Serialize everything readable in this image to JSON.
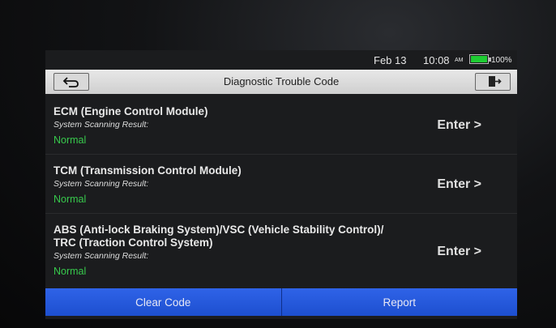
{
  "status": {
    "date": "Feb 13",
    "time": "10:08",
    "ampm": "AM",
    "battery_pct": "100%",
    "battery_level": 1.0
  },
  "header": {
    "title": "Diagnostic Trouble Code",
    "back_icon": "back-arrow-icon",
    "exit_icon": "exit-door-icon"
  },
  "systems": [
    {
      "name": "ECM (Engine Control Module)",
      "scan_label": "System Scanning Result:",
      "result": "Normal",
      "enter": "Enter >"
    },
    {
      "name": "TCM (Transmission Control Module)",
      "scan_label": "System Scanning Result:",
      "result": "Normal",
      "enter": "Enter >"
    },
    {
      "name_line1": "ABS (Anti-lock Braking System)/VSC (Vehicle Stability Control)/",
      "name_line2": "TRC (Traction Control System)",
      "scan_label": "System Scanning Result:",
      "result": "Normal",
      "enter": "Enter >"
    }
  ],
  "actions": {
    "clear_code": "Clear Code",
    "report": "Report"
  },
  "colors": {
    "accent": "#2f63e8",
    "normal": "#37c94c",
    "header_bg": "#d9d9d9"
  }
}
